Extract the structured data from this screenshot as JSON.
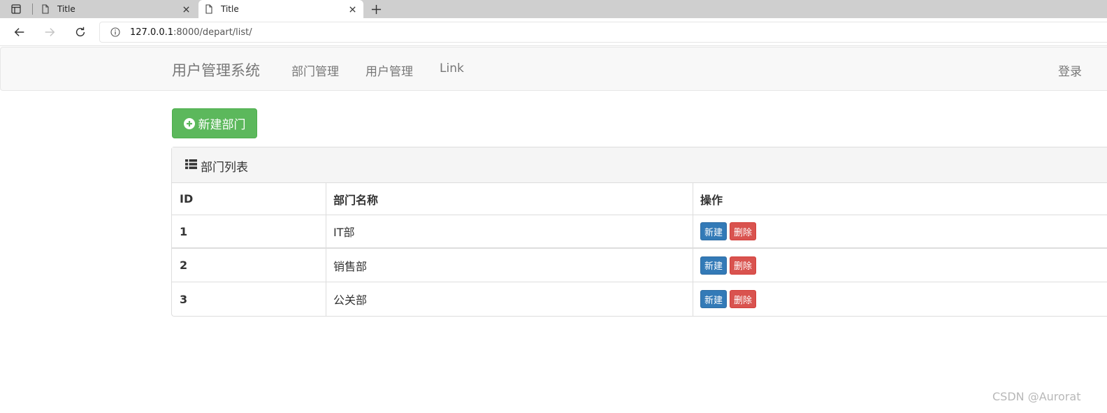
{
  "browser": {
    "tabs": [
      {
        "title": "Title",
        "active": false
      },
      {
        "title": "Title",
        "active": true
      }
    ],
    "url_host": "127.0.0.1",
    "url_path": ":8000/depart/list/"
  },
  "navbar": {
    "brand": "用户管理系统",
    "links": [
      "部门管理",
      "用户管理",
      "Link"
    ],
    "login": "登录"
  },
  "actions": {
    "new_department": "新建部门"
  },
  "panel": {
    "title": "部门列表",
    "columns": [
      "ID",
      "部门名称",
      "操作"
    ],
    "rows": [
      {
        "id": "1",
        "name": "IT部",
        "edit": "新建",
        "delete": "删除"
      },
      {
        "id": "2",
        "name": "销售部",
        "edit": "新建",
        "delete": "删除"
      },
      {
        "id": "3",
        "name": "公关部",
        "edit": "新建",
        "delete": "删除"
      }
    ]
  },
  "watermark": "CSDN @Aurorat",
  "colors": {
    "success": "#5cb85c",
    "primary": "#337ab7",
    "danger": "#d9534f"
  }
}
